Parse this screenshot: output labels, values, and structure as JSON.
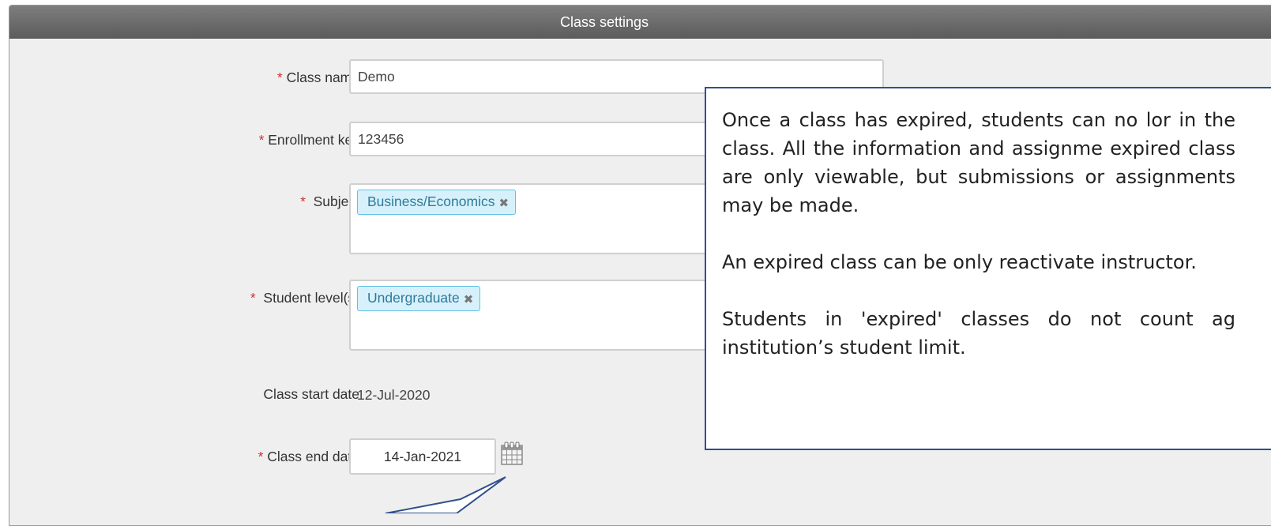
{
  "window": {
    "title": "Class settings"
  },
  "form": {
    "required_marker": "*",
    "class_name": {
      "label": "Class name",
      "value": "Demo"
    },
    "enrollment_key": {
      "label": "Enrollment key",
      "value": "123456"
    },
    "subject": {
      "label": "Subject",
      "tags": [
        "Business/Economics"
      ]
    },
    "student_levels": {
      "label": "Student level(s)",
      "tags": [
        "Undergraduate"
      ]
    },
    "start_date": {
      "label": "Class start date",
      "value": "12-Jul-2020"
    },
    "end_date": {
      "label": "Class end date",
      "value": "14-Jan-2021"
    },
    "tag_remove_glyph": "✖"
  },
  "callout": {
    "paragraphs": [
      "Once a class has expired, students can no lor in the class. All the information and assignme expired class are only viewable, but submissions or assignments may be made.",
      "An expired class can be only reactivate instructor.",
      "Students in 'expired' classes do not count ag institution’s student limit."
    ]
  },
  "icons": {
    "calendar": "calendar-icon",
    "tag_remove": "close-icon"
  },
  "colors": {
    "header": "#6a6a6a",
    "required": "#d03030",
    "tag_bg": "#d6f1fb",
    "tag_border": "#62c0e3",
    "callout_border": "#31508a"
  }
}
